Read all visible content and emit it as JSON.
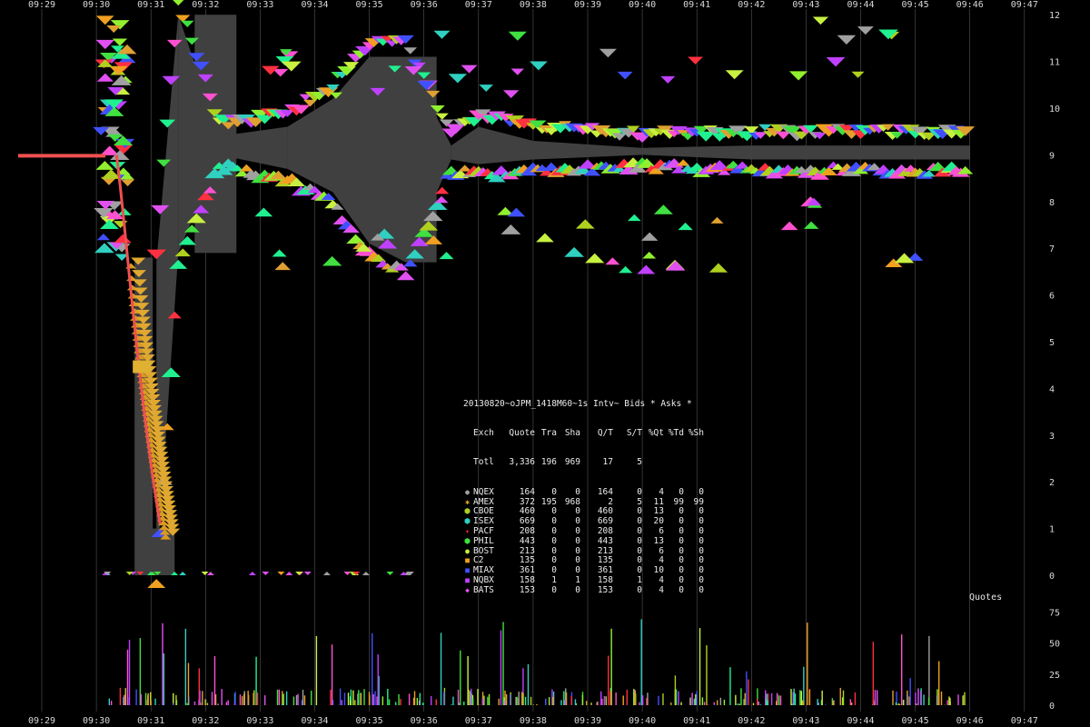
{
  "chart_data": [
    {
      "type": "scatter",
      "title": "20130820~oJPM_1418M60~1s Intv~ Bids * Asks *",
      "x_ticks": [
        "09:29",
        "09:30",
        "09:31",
        "09:32",
        "09:33",
        "09:34",
        "09:35",
        "09:36",
        "09:37",
        "09:38",
        "09:39",
        "09:40",
        "09:41",
        "09:42",
        "09:43",
        "09:44",
        "09:45",
        "09:46",
        "09:47"
      ],
      "y_ticks": [
        0,
        1,
        2,
        3,
        4,
        5,
        6,
        7,
        8,
        9,
        10,
        11,
        12
      ],
      "ylim": [
        0,
        12
      ],
      "grid": true,
      "nbbo_spread": [
        {
          "t": "09:31:06",
          "bid": 0.0,
          "ask": 6.7
        },
        {
          "t": "09:31:30",
          "bid": 6.9,
          "ask": 12.0
        },
        {
          "t": "09:32:15",
          "bid": 9.0,
          "ask": 9.4
        },
        {
          "t": "09:33:30",
          "bid": 8.7,
          "ask": 9.6
        },
        {
          "t": "09:34:20",
          "bid": 8.2,
          "ask": 10.2
        },
        {
          "t": "09:35:00",
          "bid": 7.1,
          "ask": 11.1
        },
        {
          "t": "09:35:40",
          "bid": 6.7,
          "ask": 11.1
        },
        {
          "t": "09:36:30",
          "bid": 8.9,
          "ask": 9.2
        },
        {
          "t": "09:37:00",
          "bid": 8.8,
          "ask": 9.6
        },
        {
          "t": "09:38:00",
          "bid": 8.9,
          "ask": 9.3
        },
        {
          "t": "09:40:00",
          "bid": 9.0,
          "ask": 9.15
        },
        {
          "t": "09:42:00",
          "bid": 8.9,
          "ask": 9.2
        },
        {
          "t": "09:44:00",
          "bid": 8.9,
          "ask": 9.2
        },
        {
          "t": "09:46:00",
          "bid": 8.9,
          "ask": 9.2
        }
      ],
      "opening_decline": {
        "start_t": "09:30:42",
        "start_price": 6.8,
        "end_t": "09:31:20",
        "end_price": 1.0
      }
    },
    {
      "type": "bar",
      "label": "Quotes",
      "y_ticks": [
        0,
        25,
        50,
        75
      ],
      "ylim": [
        0,
        80
      ]
    }
  ],
  "stats_table": {
    "title": "20130820~oJPM_1418M60~1s Intv~ Bids * Asks *",
    "headers": [
      "Exch",
      "Quote",
      "Tra",
      "Sha",
      "Q/T",
      "S/T",
      "%Qt",
      "%Td",
      "%Sh"
    ],
    "total": [
      "Totl",
      "3,336",
      "196",
      "969",
      "17",
      "5",
      "",
      "",
      ""
    ],
    "rows": [
      {
        "ex": "NQEX",
        "quote": "164",
        "tra": "0",
        "sha": "0",
        "qt": "164",
        "st": "0",
        "pq": "4",
        "pt": "0",
        "ps": "0",
        "color": "#a0a0a0",
        "marker": "●"
      },
      {
        "ex": "AMEX",
        "quote": "372",
        "tra": "195",
        "sha": "968",
        "qt": "2",
        "st": "5",
        "pq": "11",
        "pt": "99",
        "ps": "99",
        "color": "#e0a030",
        "marker": "✱"
      },
      {
        "ex": "CBOE",
        "quote": "460",
        "tra": "0",
        "sha": "0",
        "qt": "460",
        "st": "0",
        "pq": "13",
        "pt": "0",
        "ps": "0",
        "color": "#b0d020",
        "marker": "⬢"
      },
      {
        "ex": "ISEX",
        "quote": "669",
        "tra": "0",
        "sha": "0",
        "qt": "669",
        "st": "0",
        "pq": "20",
        "pt": "0",
        "ps": "0",
        "color": "#30d0c0",
        "marker": "⬢"
      },
      {
        "ex": "PACF",
        "quote": "208",
        "tra": "0",
        "sha": "0",
        "qt": "208",
        "st": "0",
        "pq": "6",
        "pt": "0",
        "ps": "0",
        "color": "#ff3040",
        "marker": "✦"
      },
      {
        "ex": "PHIL",
        "quote": "443",
        "tra": "0",
        "sha": "0",
        "qt": "443",
        "st": "0",
        "pq": "13",
        "pt": "0",
        "ps": "0",
        "color": "#40e040",
        "marker": "⬢"
      },
      {
        "ex": "BOST",
        "quote": "213",
        "tra": "0",
        "sha": "0",
        "qt": "213",
        "st": "0",
        "pq": "6",
        "pt": "0",
        "ps": "0",
        "color": "#c8f040",
        "marker": "●"
      },
      {
        "ex": "C2",
        "quote": "135",
        "tra": "0",
        "sha": "0",
        "qt": "135",
        "st": "0",
        "pq": "4",
        "pt": "0",
        "ps": "0",
        "color": "#f0a020",
        "marker": "■"
      },
      {
        "ex": "MIAX",
        "quote": "361",
        "tra": "0",
        "sha": "0",
        "qt": "361",
        "st": "0",
        "pq": "10",
        "pt": "0",
        "ps": "0",
        "color": "#4050ff",
        "marker": "■"
      },
      {
        "ex": "NQBX",
        "quote": "158",
        "tra": "1",
        "sha": "1",
        "qt": "158",
        "st": "1",
        "pq": "4",
        "pt": "0",
        "ps": "0",
        "color": "#c040ff",
        "marker": "■"
      },
      {
        "ex": "BATS",
        "quote": "153",
        "tra": "0",
        "sha": "0",
        "qt": "153",
        "st": "0",
        "pq": "4",
        "pt": "0",
        "ps": "0",
        "color": "#e050f0",
        "marker": "◆"
      }
    ]
  },
  "quotes_label": "Quotes",
  "colors": {
    "spread": "#404040",
    "grid": "#555555",
    "background": "#000000",
    "trade_line": "#f05050"
  }
}
